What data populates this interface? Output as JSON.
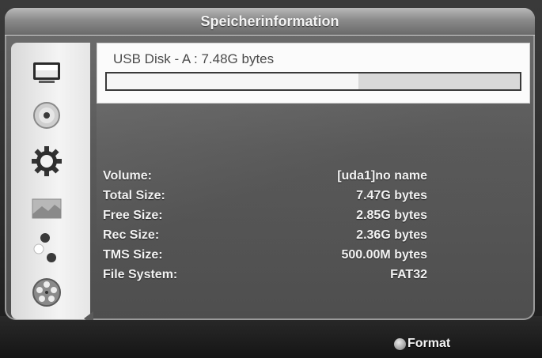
{
  "title": "Speicherinformation",
  "disk": {
    "label": "USB Disk - A : 7.48G bytes",
    "used_fraction": 0.61
  },
  "info": {
    "rows": [
      {
        "label": "Volume:",
        "value": "[uda1]no name"
      },
      {
        "label": "Total Size:",
        "value": "7.47G bytes"
      },
      {
        "label": "Free Size:",
        "value": "2.85G bytes"
      },
      {
        "label": "Rec Size:",
        "value": "2.36G bytes"
      },
      {
        "label": "TMS Size:",
        "value": "500.00M bytes"
      },
      {
        "label": "File System:",
        "value": "FAT32"
      }
    ]
  },
  "footer": {
    "format_label": "Format"
  },
  "sidebar": {
    "icons": [
      "monitor-icon",
      "disc-icon",
      "gear-icon",
      "picture-icon",
      "network-icon",
      "media-reel-icon"
    ]
  }
}
